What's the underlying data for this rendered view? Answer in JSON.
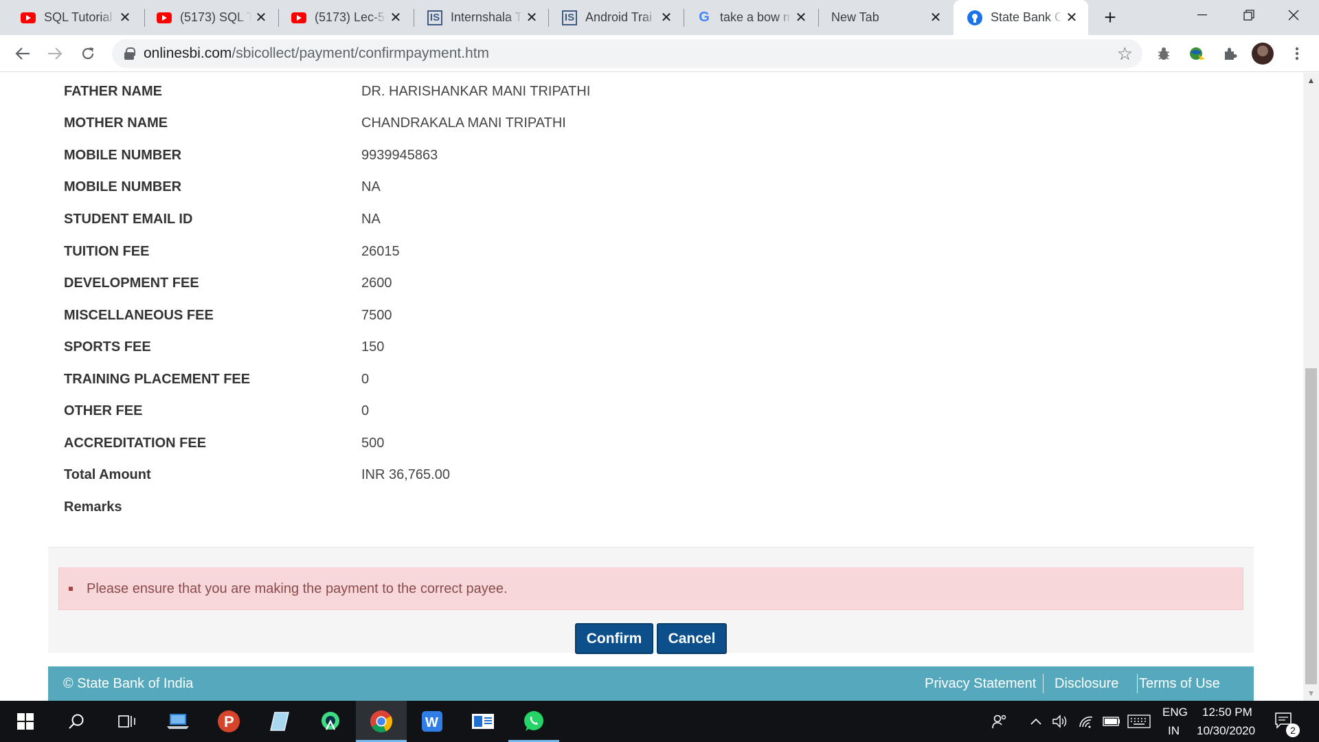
{
  "browser": {
    "tabs": [
      {
        "title": "SQL Tutorial",
        "favicon": "youtube-icon"
      },
      {
        "title": "(5173) SQL T",
        "favicon": "youtube-icon"
      },
      {
        "title": "(5173) Lec-5",
        "favicon": "youtube-icon"
      },
      {
        "title": "Internshala T",
        "favicon": "internshala-icon"
      },
      {
        "title": "Android Trai",
        "favicon": "internshala-icon"
      },
      {
        "title": "take a bow m",
        "favicon": "google-icon"
      },
      {
        "title": "New Tab",
        "favicon": ""
      },
      {
        "title": "State Bank C",
        "favicon": "sbi-icon",
        "active": true
      }
    ],
    "url_domain": "onlinesbi.com",
    "url_path": "/sbicollect/payment/confirmpayment.htm"
  },
  "details": [
    {
      "label": "FATHER NAME",
      "value": "DR. HARISHANKAR MANI TRIPATHI"
    },
    {
      "label": "MOTHER NAME",
      "value": "CHANDRAKALA MANI TRIPATHI"
    },
    {
      "label": "MOBILE NUMBER",
      "value": "9939945863"
    },
    {
      "label": "MOBILE NUMBER",
      "value": "NA"
    },
    {
      "label": "STUDENT EMAIL ID",
      "value": "NA"
    },
    {
      "label": "TUITION FEE",
      "value": "26015"
    },
    {
      "label": "DEVELOPMENT FEE",
      "value": "2600"
    },
    {
      "label": "MISCELLANEOUS FEE",
      "value": "7500"
    },
    {
      "label": "SPORTS FEE",
      "value": "150"
    },
    {
      "label": "TRAINING PLACEMENT FEE",
      "value": "0"
    },
    {
      "label": "OTHER FEE",
      "value": "0"
    },
    {
      "label": "ACCREDITATION FEE",
      "value": "500"
    },
    {
      "label": "Total Amount",
      "value": "INR 36,765.00"
    },
    {
      "label": "Remarks",
      "value": ""
    }
  ],
  "alert": {
    "message": "Please ensure that you are making the payment to the correct payee."
  },
  "actions": {
    "confirm": "Confirm",
    "cancel": "Cancel"
  },
  "footer": {
    "copyright": "© State Bank of India",
    "links": [
      "Privacy Statement",
      "Disclosure",
      "Terms of Use"
    ]
  },
  "taskbar": {
    "time": "12:50 PM",
    "date": "10/30/2020",
    "lang_top": "ENG",
    "lang_bottom": "IN",
    "notification_count": "2"
  },
  "colors": {
    "primary_button": "#0d4f8b",
    "footer_bg": "#56a9bd",
    "alert_bg": "#f8d7da"
  }
}
